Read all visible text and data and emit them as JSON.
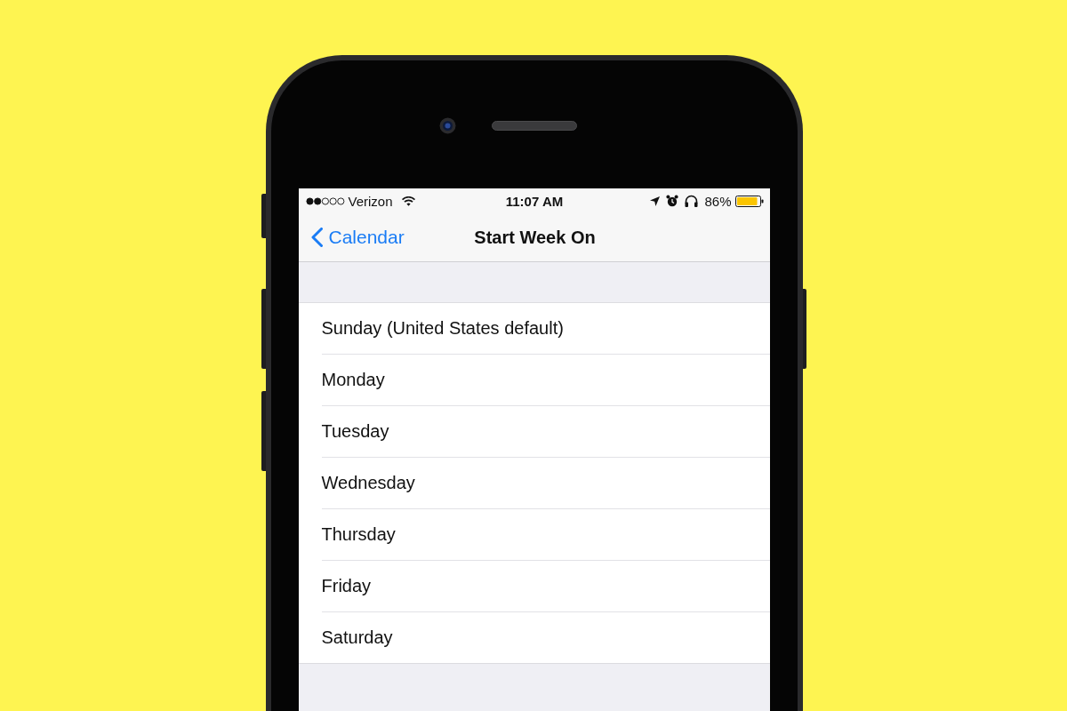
{
  "status_bar": {
    "carrier": "Verizon",
    "time": "11:07 AM",
    "battery": "86%"
  },
  "nav_bar": {
    "back": "Calendar",
    "title": "Start Week On"
  },
  "options": [
    {
      "label": "Sunday (United States default)",
      "selected": false
    },
    {
      "label": "Monday",
      "selected": false
    },
    {
      "label": "Tuesday",
      "selected": false
    },
    {
      "label": "Wednesday",
      "selected": false
    },
    {
      "label": "Thursday",
      "selected": false
    },
    {
      "label": "Friday",
      "selected": false
    },
    {
      "label": "Saturday",
      "selected": false
    }
  ]
}
